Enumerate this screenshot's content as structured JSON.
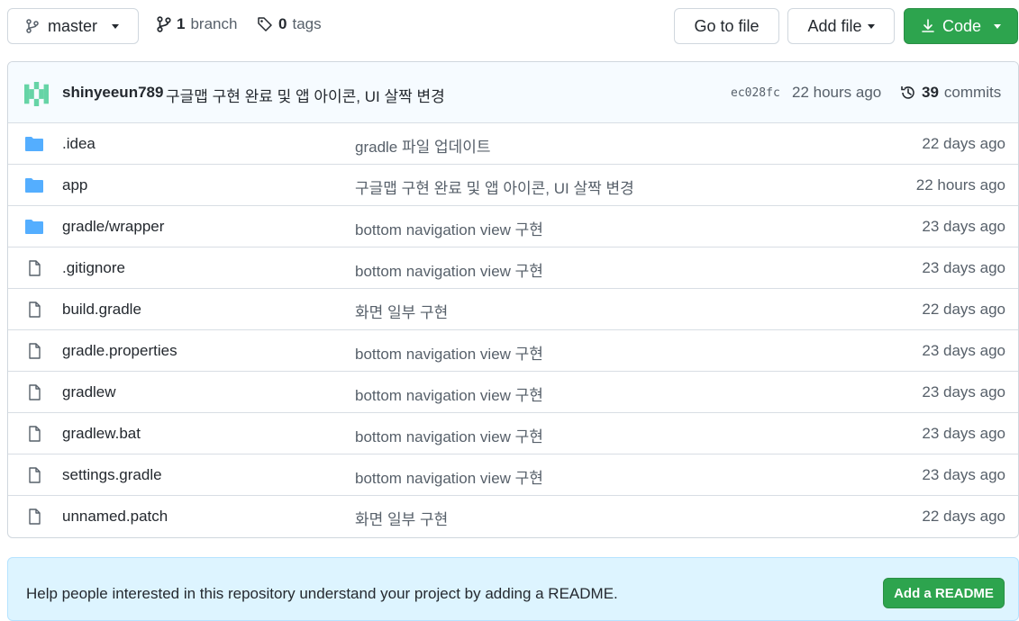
{
  "toolbar": {
    "branch_label": "master",
    "branch_count": "1",
    "branch_word": "branch",
    "tag_count": "0",
    "tag_word": "tags",
    "go_to_file": "Go to file",
    "add_file": "Add file",
    "code": "Code"
  },
  "commit": {
    "author": "shinyeeun789",
    "message": "구글맵 구현 완료 및 앱 아이콘, UI 살짝 변경",
    "sha": "ec028fc",
    "time": "22 hours ago",
    "count": "39",
    "count_word": "commits"
  },
  "files": [
    {
      "type": "folder",
      "name": ".idea",
      "message": "gradle 파일 업데이트",
      "time": "22 days ago"
    },
    {
      "type": "folder",
      "name": "app",
      "message": "구글맵 구현 완료 및 앱 아이콘, UI 살짝 변경",
      "time": "22 hours ago"
    },
    {
      "type": "folder",
      "name": "gradle/wrapper",
      "message": "bottom navigation view 구현",
      "time": "23 days ago"
    },
    {
      "type": "file",
      "name": ".gitignore",
      "message": "bottom navigation view 구현",
      "time": "23 days ago"
    },
    {
      "type": "file",
      "name": "build.gradle",
      "message": "화면 일부 구현",
      "time": "22 days ago"
    },
    {
      "type": "file",
      "name": "gradle.properties",
      "message": "bottom navigation view 구현",
      "time": "23 days ago"
    },
    {
      "type": "file",
      "name": "gradlew",
      "message": "bottom navigation view 구현",
      "time": "23 days ago"
    },
    {
      "type": "file",
      "name": "gradlew.bat",
      "message": "bottom navigation view 구현",
      "time": "23 days ago"
    },
    {
      "type": "file",
      "name": "settings.gradle",
      "message": "bottom navigation view 구현",
      "time": "23 days ago"
    },
    {
      "type": "file",
      "name": "unnamed.patch",
      "message": "화면 일부 구현",
      "time": "22 days ago"
    }
  ],
  "readme": {
    "text": "Help people interested in this repository understand your project by adding a README.",
    "button": "Add a README"
  },
  "colors": {
    "folder": "#54aeff",
    "file": "#57606a",
    "primary_green": "#2da44e",
    "readme_bg": "#ddf4ff"
  }
}
